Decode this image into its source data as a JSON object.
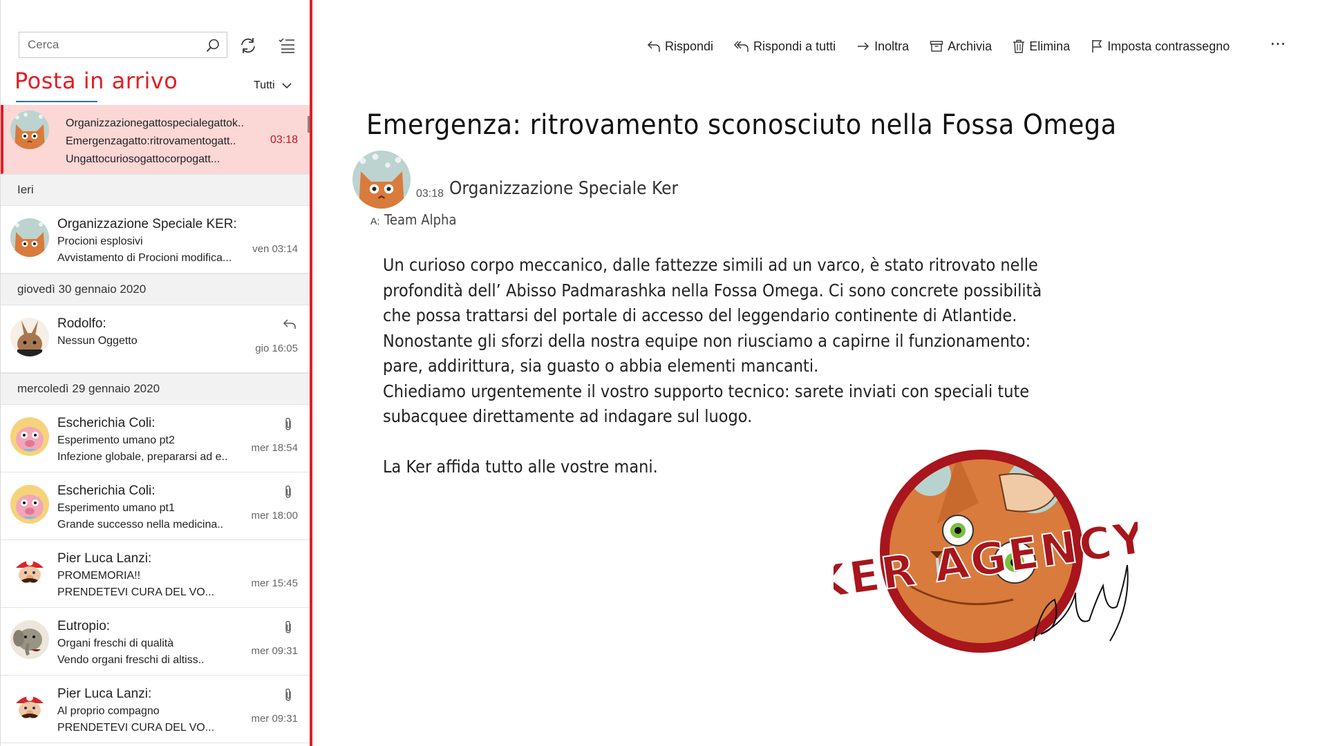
{
  "search": {
    "placeholder": "Cerca"
  },
  "inbox": {
    "title": "Posta in arrivo",
    "filter": "Tutti"
  },
  "selected_mail": {
    "line1": "Organizzazionegattospecialegattok..",
    "line2": "Emergenzagatto:ritrovamentogatt..",
    "line3": "Ungattocuriosogattocorpogatt...",
    "time": "03:18"
  },
  "groups": [
    {
      "header": "Ieri",
      "items": [
        {
          "sender": "Organizzazione Speciale KER:",
          "subject": "Procioni esplosivi",
          "preview": "Avvistamento di Procioni modifica...",
          "time": "ven 03:14",
          "avatar": "cat",
          "flag": ""
        }
      ]
    },
    {
      "header": "giovedì 30 gennaio 2020",
      "items": [
        {
          "sender": "Rodolfo:",
          "subject": "Nessun Oggetto",
          "preview": "",
          "time": "gio 16:05",
          "avatar": "rabbit",
          "flag": "replied-icon"
        }
      ]
    },
    {
      "header": "mercoledì 29 gennaio 2020",
      "items": [
        {
          "sender": "Escherichia Coli:",
          "subject": "Esperimento umano pt2",
          "preview": "Infezione globale, prepararsi ad e..",
          "time": "mer 18:54",
          "avatar": "pig",
          "flag": "attachment-icon"
        },
        {
          "sender": "Escherichia Coli:",
          "subject": "Esperimento umano pt1",
          "preview": "Grande successo nella medicina..",
          "time": "mer 18:00",
          "avatar": "pig",
          "flag": "attachment-icon"
        },
        {
          "sender": "Pier Luca Lanzi:",
          "subject": "PROMEMORIA!!",
          "preview": "PRENDETEVI CURA DEL VO...",
          "time": "mer 15:45",
          "avatar": "mario",
          "flag": ""
        },
        {
          "sender": "Eutropio:",
          "subject": "Organi freschi di qualità",
          "preview": "Vendo organi freschi di altiss..",
          "time": "mer 09:31",
          "avatar": "elephant",
          "flag": "attachment-icon"
        },
        {
          "sender": "Pier Luca Lanzi:",
          "subject": "Al proprio compagno",
          "preview": "PRENDETEVI CURA DEL VO...",
          "time": "mer 09:31",
          "avatar": "mario",
          "flag": "attachment-icon"
        }
      ]
    }
  ],
  "toolbar": {
    "reply": "Rispondi",
    "reply_all": "Rispondi a tutti",
    "forward": "Inoltra",
    "archive": "Archivia",
    "delete": "Elimina",
    "flag": "Imposta contrassegno",
    "more": "···"
  },
  "message": {
    "subject": "Emergenza: ritrovamento sconosciuto nella Fossa Omega",
    "time": "03:18",
    "sender": "Organizzazione Speciale Ker",
    "to_label": "A:",
    "to": "Team Alpha",
    "body": [
      "Un curioso corpo meccanico, dalle fattezze simili ad un varco, è stato ritrovato nelle",
      "profondità dell’   Abisso Padmarashka  nella Fossa Omega. Ci sono concrete possibilità",
      "che possa trattarsi del portale di accesso del leggendario continente di Atlantide.",
      "Nonostante gli sforzi della nostra equipe non riusciamo a capirne il funzionamento:",
      "pare, addirittura, sia guasto o abbia elementi mancanti.",
      "Chiediamo urgentemente il vostro supporto tecnico: sarete inviati con speciali tute",
      "subacquee direttamente ad indagare sul luogo.",
      "",
      "La Ker affida tutto alle vostre mani."
    ],
    "stamp_text": "KER AGENCY"
  },
  "colors": {
    "accent": "#e51c23",
    "selected_bg": "#fbd7d6",
    "stamp": "#a8151c",
    "cat": "#d97b3c"
  }
}
